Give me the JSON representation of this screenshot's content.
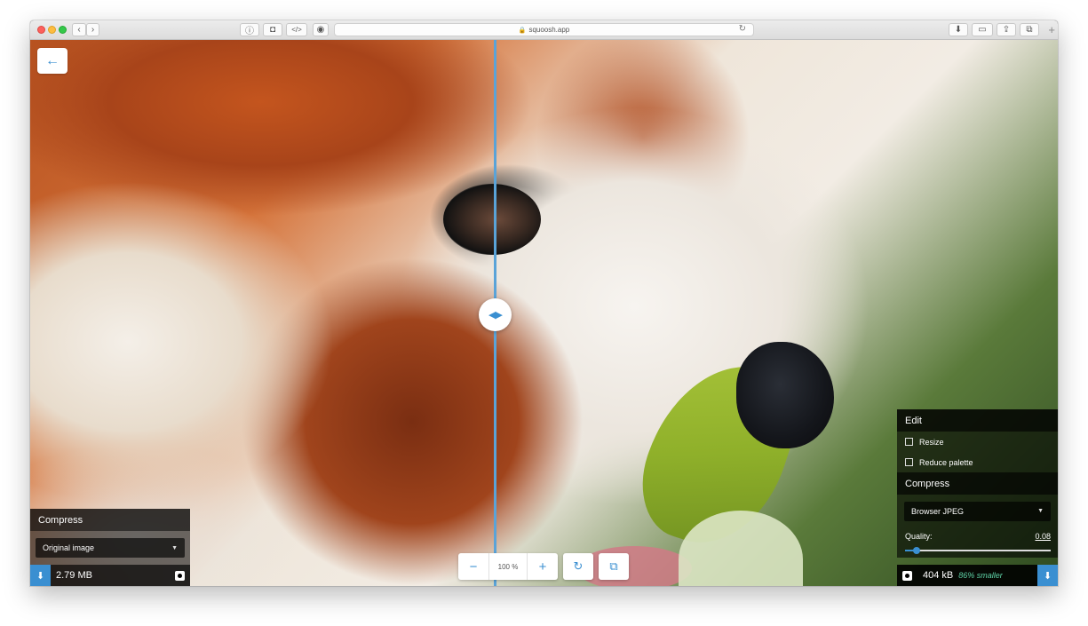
{
  "browser": {
    "url": "squoosh.app",
    "nav_back_glyph": "‹",
    "nav_forward_glyph": "›",
    "reload_glyph": "↻",
    "new_tab_glyph": "+"
  },
  "app": {
    "back_glyph": "←",
    "accent_color": "#3a8fd1",
    "left_panel": {
      "title": "Compress",
      "selected_option": "Original image",
      "file_size": "2.79 MB"
    },
    "right_panel": {
      "edit_title": "Edit",
      "resize_label": "Resize",
      "reduce_palette_label": "Reduce palette",
      "compress_title": "Compress",
      "selected_codec": "Browser JPEG",
      "quality_label": "Quality:",
      "quality_value": "0.08",
      "quality_fraction": 0.08,
      "file_size": "404 kB",
      "savings": "86% smaller"
    },
    "zoom": {
      "minus_glyph": "−",
      "value": "100 %",
      "plus_glyph": "+",
      "rotate_glyph": "↻",
      "side_by_side_glyph": "⧉"
    },
    "divider_glyph": "◀▶"
  }
}
